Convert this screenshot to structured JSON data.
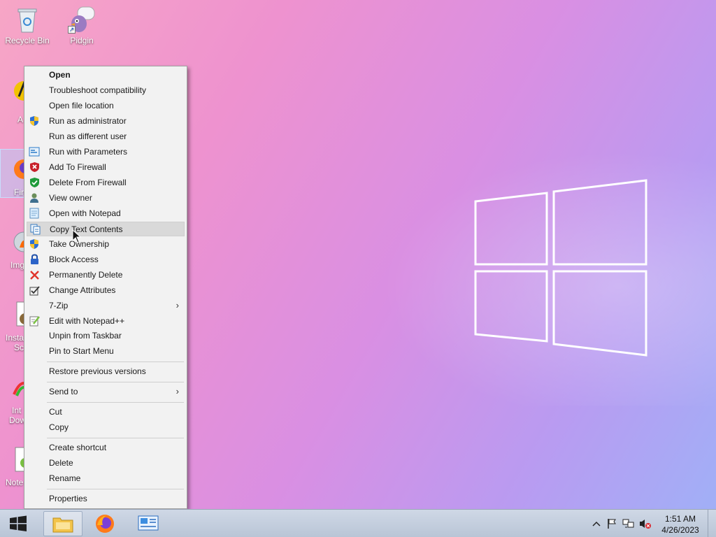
{
  "desktop": {
    "icons": [
      {
        "label": "Recycle Bin",
        "icon": "recycle-bin-icon"
      },
      {
        "label": "Pidgin",
        "icon": "pidgin-icon"
      }
    ],
    "partial_labels": [
      "A",
      "Fir",
      "Img",
      "Insta",
      "Sc",
      "Int",
      "Dow",
      "Note"
    ]
  },
  "context_menu": {
    "items": [
      {
        "label": "Open",
        "bold": true,
        "icon": ""
      },
      {
        "label": "Troubleshoot compatibility",
        "icon": ""
      },
      {
        "label": "Open file location",
        "icon": ""
      },
      {
        "label": "Run as administrator",
        "icon": "uac-shield-icon"
      },
      {
        "label": "Run as different user",
        "icon": ""
      },
      {
        "label": "Run with Parameters",
        "icon": "parameters-icon"
      },
      {
        "label": "Add To Firewall",
        "icon": "firewall-add-icon"
      },
      {
        "label": "Delete From Firewall",
        "icon": "firewall-delete-icon"
      },
      {
        "label": "View owner",
        "icon": "user-icon"
      },
      {
        "label": "Open with Notepad",
        "icon": "notepad-icon"
      },
      {
        "label": "Copy Text Contents",
        "icon": "copy-text-icon",
        "hovered": true
      },
      {
        "label": "Take Ownership",
        "icon": "uac-shield-icon"
      },
      {
        "label": "Block Access",
        "icon": "lock-icon"
      },
      {
        "label": "Permanently Delete",
        "icon": "red-x-icon"
      },
      {
        "label": "Change Attributes",
        "icon": "checkbox-icon"
      },
      {
        "label": "7-Zip",
        "icon": "",
        "submenu": true
      },
      {
        "label": "Edit with Notepad++",
        "icon": "notepadpp-icon"
      },
      {
        "label": "Unpin from Taskbar",
        "icon": ""
      },
      {
        "label": "Pin to Start Menu",
        "icon": ""
      },
      {
        "label": "Restore previous versions",
        "icon": ""
      },
      {
        "label": "Send to",
        "icon": "",
        "submenu": true
      },
      {
        "label": "Cut",
        "icon": ""
      },
      {
        "label": "Copy",
        "icon": ""
      },
      {
        "label": "Create shortcut",
        "icon": ""
      },
      {
        "label": "Delete",
        "icon": ""
      },
      {
        "label": "Rename",
        "icon": ""
      },
      {
        "label": "Properties",
        "icon": ""
      }
    ],
    "submenu_arrow": "›"
  },
  "taskbar": {
    "pinned": [
      {
        "name": "file-explorer",
        "icon": "folder-icon"
      },
      {
        "name": "firefox",
        "icon": "firefox-icon"
      },
      {
        "name": "control-panel",
        "icon": "control-panel-icon"
      }
    ],
    "tray": [
      "show-hidden-icons-chevron",
      "action-center-flag-icon",
      "network-icon",
      "volume-muted-icon"
    ],
    "clock": {
      "time": "1:51 AM",
      "date": "4/26/2023"
    }
  },
  "colors": {
    "accent": "#1a5fd0",
    "menu_bg": "#f2f2f2",
    "menu_hover": "#d9d9d9",
    "taskbar": "#c3cddc"
  }
}
